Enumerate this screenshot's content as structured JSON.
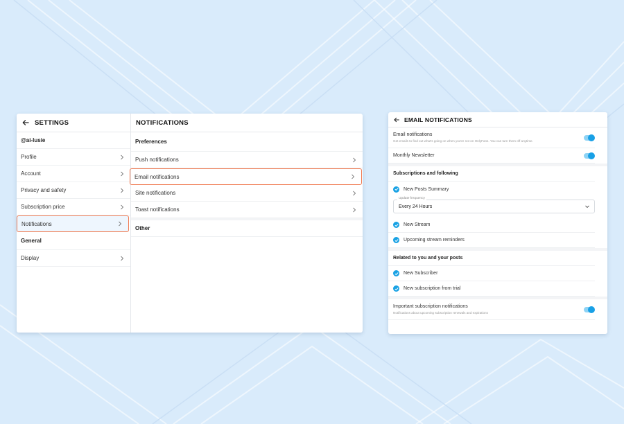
{
  "settings": {
    "title": "SETTINGS",
    "username": "@ai-lusie",
    "items": [
      {
        "label": "Profile"
      },
      {
        "label": "Account"
      },
      {
        "label": "Privacy and safety"
      },
      {
        "label": "Subscription price"
      },
      {
        "label": "Notifications"
      }
    ],
    "general_label": "General",
    "general_items": [
      {
        "label": "Display"
      }
    ]
  },
  "notifications": {
    "title": "NOTIFICATIONS",
    "preferences_label": "Preferences",
    "items": [
      {
        "label": "Push notifications"
      },
      {
        "label": "Email notifications"
      },
      {
        "label": "Site notifications"
      },
      {
        "label": "Toast notifications"
      }
    ],
    "other_label": "Other"
  },
  "email": {
    "title": "EMAIL NOTIFICATIONS",
    "email_toggle_label": "Email notifications",
    "email_toggle_sub": "Get emails to find out what's going on when you're not on OnlyFans. You can turn them off anytime.",
    "newsletter_label": "Monthly Newsletter",
    "subs_section": "Subscriptions and following",
    "new_posts_summary": "New Posts Summary",
    "update_frequency_label": "Update frequency",
    "update_frequency_value": "Every 24 Hours",
    "new_stream": "New Stream",
    "upcoming_stream": "Upcoming stream reminders",
    "related_section": "Related to you and your posts",
    "new_subscriber": "New Subscriber",
    "new_sub_trial": "New subscription from trial",
    "important_label": "Important subscription notifications",
    "important_sub": "Notifications about upcoming subscription renewals and expirations"
  },
  "colors": {
    "accent": "#19a2e4",
    "highlight_border": "#f07b53",
    "background": "#d9ebfb"
  }
}
